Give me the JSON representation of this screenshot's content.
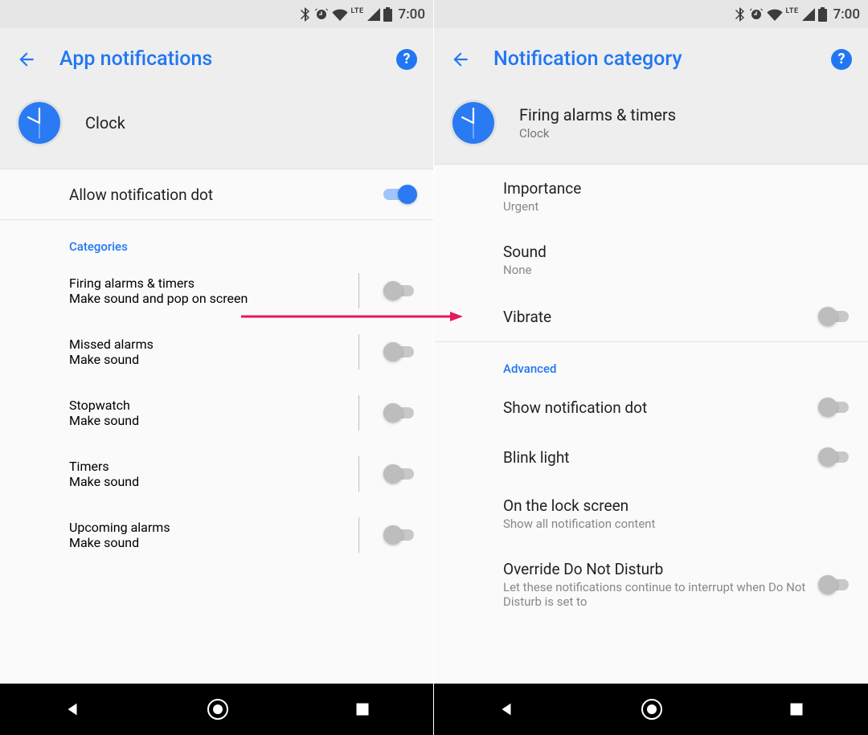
{
  "status": {
    "lte": "LTE",
    "time": "7:00"
  },
  "left": {
    "title": "App notifications",
    "app_name": "Clock",
    "allow_dot_label": "Allow notification dot",
    "categories_header": "Categories",
    "categories": [
      {
        "title": "Firing alarms & timers",
        "sub": "Make sound and pop on screen"
      },
      {
        "title": "Missed alarms",
        "sub": "Make sound"
      },
      {
        "title": "Stopwatch",
        "sub": "Make sound"
      },
      {
        "title": "Timers",
        "sub": "Make sound"
      },
      {
        "title": "Upcoming alarms",
        "sub": "Make sound"
      }
    ]
  },
  "right": {
    "title": "Notification category",
    "channel_title": "Firing alarms & timers",
    "channel_sub": "Clock",
    "importance_label": "Importance",
    "importance_value": "Urgent",
    "sound_label": "Sound",
    "sound_value": "None",
    "vibrate_label": "Vibrate",
    "advanced_header": "Advanced",
    "show_dot_label": "Show notification dot",
    "blink_label": "Blink light",
    "lockscreen_label": "On the lock screen",
    "lockscreen_value": "Show all notification content",
    "dnd_label": "Override Do Not Disturb",
    "dnd_sub": "Let these notifications continue to interrupt when Do Not Disturb is set to"
  }
}
